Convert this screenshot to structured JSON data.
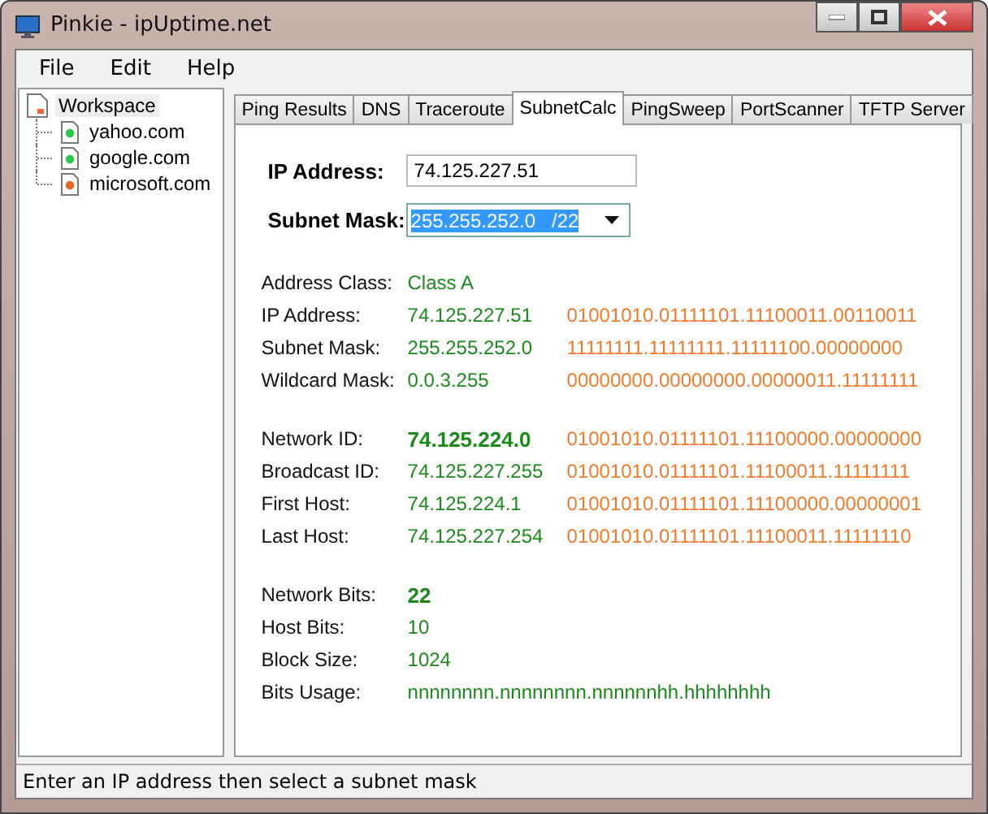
{
  "window": {
    "title": "Pinkie - ipUptime.net"
  },
  "menu": [
    "File",
    "Edit",
    "Help"
  ],
  "tree": {
    "label": "Workspace",
    "selected": true,
    "children": [
      {
        "label": "yahoo.com",
        "color": "#22cc44",
        "selected": false
      },
      {
        "label": "google.com",
        "color": "#22cc44",
        "selected": false
      },
      {
        "label": "microsoft.com",
        "color": "#ee6622",
        "selected": false
      }
    ]
  },
  "tabs": [
    {
      "label": "Ping Results",
      "selected": false
    },
    {
      "label": "DNS",
      "selected": false
    },
    {
      "label": "Traceroute",
      "selected": false
    },
    {
      "label": "SubnetCalc",
      "selected": true
    },
    {
      "label": "PingSweep",
      "selected": false
    },
    {
      "label": "PortScanner",
      "selected": false
    },
    {
      "label": "TFTP Server",
      "selected": false
    }
  ],
  "form": {
    "ip_label": "IP Address:",
    "ip_value": "74.125.227.51",
    "mask_label": "Subnet Mask:",
    "mask_value": "255.255.252.0   /22"
  },
  "results": [
    [
      {
        "label": "Address Class:",
        "value": "Class A",
        "bold": false
      },
      {
        "label": "IP Address:",
        "value": "74.125.227.51",
        "binary": "01001010.01111101.11100011.00110011",
        "bold": false
      },
      {
        "label": "Subnet Mask:",
        "value": "255.255.252.0",
        "binary": "11111111.11111111.11111100.00000000",
        "bold": false
      },
      {
        "label": "Wildcard Mask:",
        "value": "0.0.3.255",
        "binary": "00000000.00000000.00000011.11111111",
        "bold": false
      }
    ],
    [
      {
        "label": "Network ID:",
        "value": "74.125.224.0",
        "binary": "01001010.01111101.11100000.00000000",
        "bold": true
      },
      {
        "label": "Broadcast ID:",
        "value": "74.125.227.255",
        "binary": "01001010.01111101.11100011.11111111",
        "bold": false
      },
      {
        "label": "First Host:",
        "value": "74.125.224.1",
        "binary": "01001010.01111101.11100000.00000001",
        "bold": false
      },
      {
        "label": "Last Host:",
        "value": "74.125.227.254",
        "binary": "01001010.01111101.11100011.11111110",
        "bold": false
      }
    ],
    [
      {
        "label": "Network Bits:",
        "value": "22",
        "bold": true
      },
      {
        "label": "Host Bits:",
        "value": "10",
        "bold": false
      },
      {
        "label": "Block Size:",
        "value": "1024",
        "bold": false
      },
      {
        "label": "Bits Usage:",
        "value": "nnnnnnnn.nnnnnnnn.nnnnnnhh.hhhhhhhh",
        "bold": false
      }
    ]
  ],
  "status_bar": "Enter an IP address then select a subnet mask"
}
